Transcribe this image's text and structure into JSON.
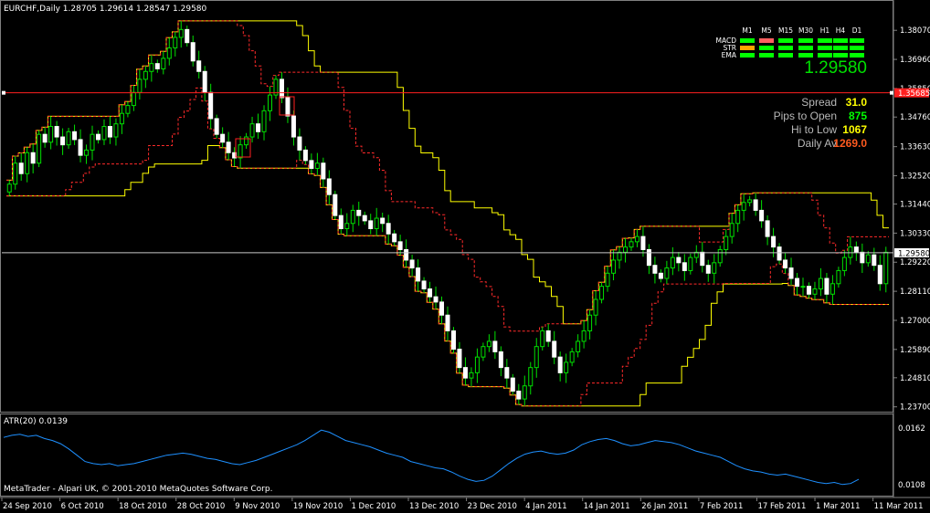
{
  "chart": {
    "header": "EURCHF,Daily  1.28705 1.29614 1.28547 1.29580",
    "copyright": "MetaTrader - Alpari UK, © 2001-2010 MetaQuotes Software Corp.",
    "indicator_label": "ATR(20) 0.0139"
  },
  "panel": {
    "timeframes": [
      "M1",
      "M5",
      "M15",
      "M30",
      "H1",
      "H4",
      "D1"
    ],
    "rows": [
      {
        "label": "MACD",
        "colors": [
          "#00ff00",
          "#ff6060",
          "#00ff00",
          "#00ff00",
          "#00ff00",
          "#00ff00",
          "#00ff00"
        ]
      },
      {
        "label": "STR",
        "colors": [
          "#ffa500",
          "#00ff00",
          "#00ff00",
          "#00ff00",
          "#00ff00",
          "#00ff00",
          "#00ff00"
        ]
      },
      {
        "label": "EMA",
        "colors": [
          "#00ff00",
          "#00ff00",
          "#00ff00",
          "#00ff00",
          "#00ff00",
          "#00ff00",
          "#00ff00"
        ]
      }
    ],
    "price": "1.29580",
    "stats": [
      {
        "label": "Spread",
        "value": "31.0",
        "color": "#ffff00"
      },
      {
        "label": "Pips to Open",
        "value": "875",
        "color": "#00ff00"
      },
      {
        "label": "Hi to Low",
        "value": "1067",
        "color": "#ffff00"
      },
      {
        "label": "Daily Av",
        "value": "1269.0",
        "color": "#ff5a1f"
      }
    ]
  },
  "chart_data": [
    {
      "type": "candlestick",
      "symbol": "EURCHF",
      "timeframe": "Daily",
      "ohlc_current": {
        "open": 1.28705,
        "high": 1.29614,
        "low": 1.28547,
        "close": 1.2958
      },
      "y_ticks": [
        "1.38070",
        "1.36960",
        "1.35850",
        "1.34760",
        "1.33630",
        "1.32520",
        "1.31440",
        "1.30330",
        "1.29220",
        "1.28110",
        "1.27000",
        "1.25890",
        "1.24810",
        "1.23700"
      ],
      "ylim": [
        1.2355,
        1.386
      ],
      "x_ticks": [
        "24 Sep 2010",
        "6 Oct 2010",
        "18 Oct 2010",
        "28 Oct 2010",
        "9 Nov 2010",
        "19 Nov 2010",
        "1 Dec 2010",
        "13 Dec 2010",
        "23 Dec 2010",
        "4 Jan 2011",
        "14 Jan 2011",
        "26 Jan 2011",
        "7 Feb 2011",
        "17 Feb 2011",
        "1 Mar 2011",
        "11 Mar 2011"
      ],
      "horizontal_lines": [
        {
          "label": "1.35685",
          "value": 1.35685,
          "color": "#ff2020"
        },
        {
          "label": "1.29580",
          "value": 1.2958,
          "color": "#c8c8c8"
        }
      ],
      "close_path": [
        1.322,
        1.33,
        1.326,
        1.334,
        1.33,
        1.341,
        1.338,
        1.344,
        1.34,
        1.337,
        1.342,
        1.339,
        1.333,
        1.335,
        1.341,
        1.339,
        1.344,
        1.34,
        1.345,
        1.349,
        1.352,
        1.357,
        1.362,
        1.365,
        1.368,
        1.366,
        1.37,
        1.374,
        1.378,
        1.381,
        1.376,
        1.369,
        1.365,
        1.357,
        1.347,
        1.341,
        1.338,
        1.334,
        1.332,
        1.337,
        1.34,
        1.345,
        1.342,
        1.35,
        1.356,
        1.362,
        1.355,
        1.348,
        1.34,
        1.335,
        1.331,
        1.328,
        1.33,
        1.324,
        1.318,
        1.31,
        1.305,
        1.307,
        1.312,
        1.31,
        1.308,
        1.305,
        1.309,
        1.307,
        1.303,
        1.3,
        1.297,
        1.293,
        1.29,
        1.285,
        1.282,
        1.279,
        1.277,
        1.272,
        1.266,
        1.259,
        1.252,
        1.248,
        1.25,
        1.256,
        1.26,
        1.262,
        1.258,
        1.252,
        1.248,
        1.243,
        1.24,
        1.245,
        1.252,
        1.26,
        1.266,
        1.262,
        1.256,
        1.25,
        1.254,
        1.258,
        1.262,
        1.266,
        1.272,
        1.278,
        1.283,
        1.288,
        1.293,
        1.296,
        1.298,
        1.3,
        1.302,
        1.297,
        1.291,
        1.288,
        1.286,
        1.29,
        1.294,
        1.292,
        1.289,
        1.294,
        1.296,
        1.291,
        1.288,
        1.292,
        1.297,
        1.302,
        1.307,
        1.312,
        1.315,
        1.316,
        1.312,
        1.308,
        1.302,
        1.298,
        1.293,
        1.29,
        1.286,
        1.283,
        1.283,
        1.28,
        1.282,
        1.286,
        1.28,
        1.284,
        1.289,
        1.294,
        1.298,
        1.296,
        1.292,
        1.295,
        1.291,
        1.284,
        1.296
      ],
      "upper_band": {
        "color": "#ffff00",
        "style": "solid"
      },
      "inner_band": {
        "color": "#ff2a2a",
        "style": "dashed"
      }
    },
    {
      "type": "line",
      "name": "ATR(20)",
      "value_label": "0.0139",
      "y_ticks": [
        "0.0162",
        "0.0108"
      ],
      "ylim": [
        0.01,
        0.0168
      ],
      "values": [
        0.0153,
        0.0155,
        0.0156,
        0.0154,
        0.0155,
        0.0152,
        0.015,
        0.0147,
        0.0142,
        0.0136,
        0.013,
        0.0128,
        0.0127,
        0.0128,
        0.0126,
        0.0127,
        0.0128,
        0.013,
        0.0132,
        0.0134,
        0.0136,
        0.0137,
        0.0138,
        0.0137,
        0.0135,
        0.0133,
        0.0132,
        0.013,
        0.0128,
        0.0127,
        0.0129,
        0.0131,
        0.0134,
        0.0137,
        0.014,
        0.0143,
        0.0146,
        0.015,
        0.0155,
        0.016,
        0.0158,
        0.0154,
        0.015,
        0.0148,
        0.0146,
        0.0144,
        0.0141,
        0.0138,
        0.0136,
        0.0134,
        0.013,
        0.0128,
        0.0126,
        0.0124,
        0.0123,
        0.012,
        0.0116,
        0.0113,
        0.0111,
        0.0112,
        0.0116,
        0.0122,
        0.0128,
        0.0133,
        0.0137,
        0.0139,
        0.014,
        0.0138,
        0.0137,
        0.0138,
        0.0141,
        0.0146,
        0.0149,
        0.0151,
        0.0152,
        0.015,
        0.0147,
        0.0145,
        0.0146,
        0.0148,
        0.015,
        0.0149,
        0.0148,
        0.0146,
        0.0143,
        0.014,
        0.0138,
        0.0136,
        0.0134,
        0.013,
        0.0126,
        0.0123,
        0.0121,
        0.012,
        0.0118,
        0.0117,
        0.0118,
        0.0116,
        0.0114,
        0.0112,
        0.011,
        0.0109,
        0.011,
        0.0108,
        0.0109,
        0.0113
      ],
      "color": "#1e90ff"
    }
  ]
}
